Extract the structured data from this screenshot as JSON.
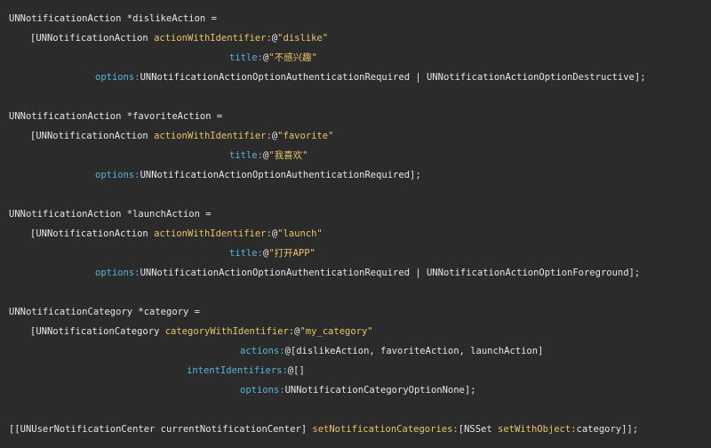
{
  "colors": {
    "background": "#2b2b2b",
    "plain": "#e6e6e6",
    "message": "#e8c468",
    "label": "#5ab4d6",
    "string": "#e8c468"
  },
  "lines": [
    {
      "indent": 10,
      "parts": [
        {
          "t": "UNNotificationAction *dislikeAction =",
          "c": "plain"
        }
      ]
    },
    {
      "indent": 34,
      "parts": [
        {
          "t": "[UNNotificationAction ",
          "c": "plain"
        },
        {
          "t": "actionWithIdentifier:",
          "c": "msg"
        },
        {
          "t": "@",
          "c": "plain"
        },
        {
          "t": "\"dislike\"",
          "c": "str"
        }
      ]
    },
    {
      "indent": 258,
      "parts": [
        {
          "t": "title:",
          "c": "lbl"
        },
        {
          "t": "@",
          "c": "plain"
        },
        {
          "t": "\"不感兴趣\"",
          "c": "str"
        }
      ]
    },
    {
      "indent": 107,
      "parts": [
        {
          "t": "options:",
          "c": "lbl"
        },
        {
          "t": "UNNotificationActionOptionAuthenticationRequired | UNNotificationActionOptionDestructive];",
          "c": "plain"
        }
      ]
    },
    {
      "indent": 10,
      "parts": []
    },
    {
      "indent": 10,
      "parts": [
        {
          "t": "UNNotificationAction *favoriteAction =",
          "c": "plain"
        }
      ]
    },
    {
      "indent": 34,
      "parts": [
        {
          "t": "[UNNotificationAction ",
          "c": "plain"
        },
        {
          "t": "actionWithIdentifier:",
          "c": "msg"
        },
        {
          "t": "@",
          "c": "plain"
        },
        {
          "t": "\"favorite\"",
          "c": "str"
        }
      ]
    },
    {
      "indent": 258,
      "parts": [
        {
          "t": "title:",
          "c": "lbl"
        },
        {
          "t": "@",
          "c": "plain"
        },
        {
          "t": "\"我喜欢\"",
          "c": "str"
        }
      ]
    },
    {
      "indent": 107,
      "parts": [
        {
          "t": "options:",
          "c": "lbl"
        },
        {
          "t": "UNNotificationActionOptionAuthenticationRequired];",
          "c": "plain"
        }
      ]
    },
    {
      "indent": 10,
      "parts": []
    },
    {
      "indent": 10,
      "parts": [
        {
          "t": "UNNotificationAction *launchAction =",
          "c": "plain"
        }
      ]
    },
    {
      "indent": 34,
      "parts": [
        {
          "t": "[UNNotificationAction ",
          "c": "plain"
        },
        {
          "t": "actionWithIdentifier:",
          "c": "msg"
        },
        {
          "t": "@",
          "c": "plain"
        },
        {
          "t": "\"launch\"",
          "c": "str"
        }
      ]
    },
    {
      "indent": 258,
      "parts": [
        {
          "t": "title:",
          "c": "lbl"
        },
        {
          "t": "@",
          "c": "plain"
        },
        {
          "t": "\"打开APP\"",
          "c": "str"
        }
      ]
    },
    {
      "indent": 107,
      "parts": [
        {
          "t": "options:",
          "c": "lbl"
        },
        {
          "t": "UNNotificationActionOptionAuthenticationRequired | UNNotificationActionOptionForeground];",
          "c": "plain"
        }
      ]
    },
    {
      "indent": 10,
      "parts": []
    },
    {
      "indent": 10,
      "parts": [
        {
          "t": "UNNotificationCategory *category =",
          "c": "plain"
        }
      ]
    },
    {
      "indent": 34,
      "parts": [
        {
          "t": "[UNNotificationCategory ",
          "c": "plain"
        },
        {
          "t": "categoryWithIdentifier:",
          "c": "msg"
        },
        {
          "t": "@",
          "c": "plain"
        },
        {
          "t": "\"my_category\"",
          "c": "str"
        }
      ]
    },
    {
      "indent": 270,
      "parts": [
        {
          "t": "actions:",
          "c": "lbl"
        },
        {
          "t": "@[dislikeAction, favoriteAction, launchAction]",
          "c": "plain"
        }
      ]
    },
    {
      "indent": 210,
      "parts": [
        {
          "t": "intentIdentifiers:",
          "c": "lbl"
        },
        {
          "t": "@[]",
          "c": "plain"
        }
      ]
    },
    {
      "indent": 270,
      "parts": [
        {
          "t": "options:",
          "c": "lbl"
        },
        {
          "t": "UNNotificationCategoryOptionNone];",
          "c": "plain"
        }
      ]
    },
    {
      "indent": 10,
      "parts": []
    },
    {
      "indent": 10,
      "parts": [
        {
          "t": "[[UNUserNotificationCenter currentNotificationCenter] ",
          "c": "plain"
        },
        {
          "t": "setNotificationCategories:",
          "c": "msg"
        },
        {
          "t": "[NSSet ",
          "c": "plain"
        },
        {
          "t": "setWithObject:",
          "c": "msg"
        },
        {
          "t": "category]];",
          "c": "plain"
        }
      ]
    }
  ]
}
